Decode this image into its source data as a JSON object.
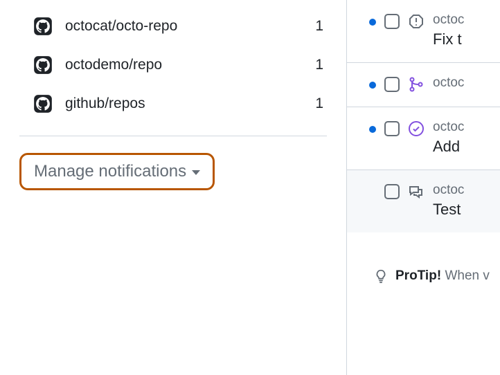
{
  "sidebar": {
    "repos": [
      {
        "name": "octocat/octo-repo",
        "count": "1"
      },
      {
        "name": "octodemo/repo",
        "count": "1"
      },
      {
        "name": "github/repos",
        "count": "1"
      }
    ],
    "manage_label": "Manage notifications"
  },
  "notifications": [
    {
      "repo": "octoc",
      "title": "Fix t",
      "type": "issue",
      "unread": true
    },
    {
      "repo": "octoc",
      "title": "",
      "type": "merge",
      "unread": true
    },
    {
      "repo": "octoc",
      "title": "Add",
      "type": "check",
      "unread": true
    },
    {
      "repo": "octoc",
      "title": "Test",
      "type": "discussion",
      "unread": false
    }
  ],
  "protip": {
    "label": "ProTip!",
    "text": "When v"
  }
}
